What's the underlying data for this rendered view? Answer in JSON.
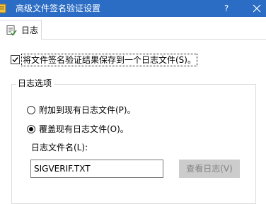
{
  "window": {
    "title": "高级文件签名验证设置",
    "icon": "app-icon",
    "help_glyph": "?",
    "close_icon": "close-icon",
    "titlebar_color": "#2b6cc4"
  },
  "tabs": [
    {
      "label": "日志",
      "icon": "log-icon",
      "selected": true
    }
  ],
  "save_log": {
    "checked": true,
    "label": "将文件签名验证结果保存到一个日志文件(S)。"
  },
  "log_options": {
    "group_title": "日志选项",
    "append": {
      "label": "附加到现有日志文件(P)。",
      "selected": false
    },
    "overwrite": {
      "label": "覆盖现有日志文件(O)。",
      "selected": true
    },
    "filename_label": "日志文件名(L):",
    "filename_value": "SIGVERIF.TXT",
    "view_button": {
      "label": "查看日志(V)",
      "enabled": false
    }
  }
}
